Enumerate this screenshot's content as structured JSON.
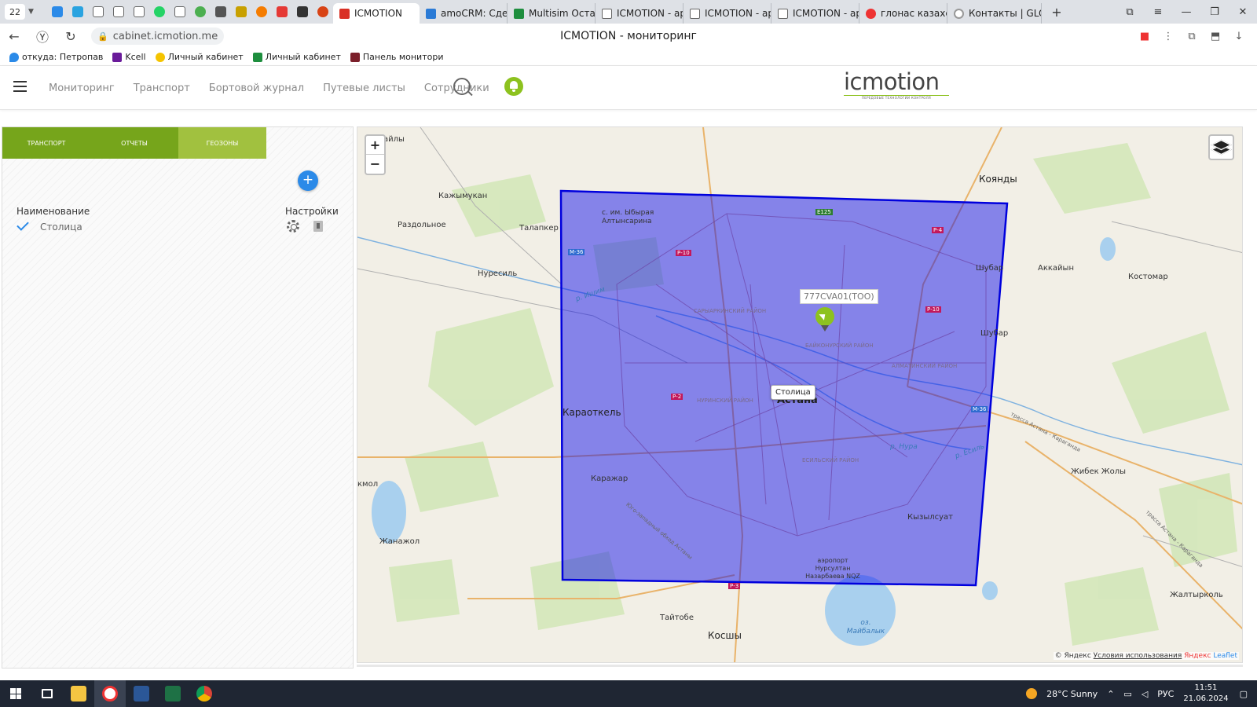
{
  "browser": {
    "tab_counter": "22",
    "tabs": [
      {
        "label": "ICMOTION",
        "color": "#d93025"
      },
      {
        "label": "amoCRM: Сдел",
        "color": "#2b7bd6"
      },
      {
        "label": "Multisim Остат",
        "color": "#1e8e3e"
      },
      {
        "label": "ICMOTION - ар",
        "color": "#666666"
      },
      {
        "label": "ICMOTION - ар",
        "color": "#666666"
      },
      {
        "label": "ICMOTION - ар",
        "color": "#666666"
      },
      {
        "label": "глонас казахст",
        "color": "#e33"
      },
      {
        "label": "Контакты | GLO",
        "color": "#999999"
      }
    ],
    "url": "cabinet.icmotion.me",
    "page_title": "ICMOTION - мониторинг",
    "bookmarks": [
      {
        "label": "откуда: Петропав",
        "color": "#2b8ae8"
      },
      {
        "label": "Kcell",
        "color": "#6a1b9a"
      },
      {
        "label": "Личный кабинет",
        "color": "#f5c400"
      },
      {
        "label": "Личный кабинет",
        "color": "#1e8e3e"
      },
      {
        "label": "Панель монитори",
        "color": "#7b1f2a"
      }
    ]
  },
  "header": {
    "nav": [
      "Мониторинг",
      "Транспорт",
      "Бортовой журнал",
      "Путевые листы",
      "Сотрудники"
    ],
    "logo_text": "icmotion",
    "logo_sub": "ПЕРЕДОВЫЕ ТЕХНОЛОГИИ КОНТРОЛЯ",
    "accent": "#8dc21f"
  },
  "panel": {
    "tabs": [
      "ТРАНСПОРТ",
      "ОТЧЕТЫ",
      "ГЕОЗОНЫ"
    ],
    "active_tab": "ГЕОЗОНЫ",
    "add_label": "+",
    "col_name": "Наименование",
    "col_settings": "Настройки",
    "rows": [
      {
        "name": "Столица",
        "checked": true
      }
    ]
  },
  "map": {
    "zoom_in": "+",
    "zoom_out": "−",
    "geozone_color": "#0000dd",
    "geozone_tooltip": "Столица",
    "vehicle_label": "777CVA01(ТОО)",
    "labels": {
      "kazhymukan": "Кажымукан",
      "razdolnoe": "Раздольное",
      "talapker": "Талапкер",
      "nuresil": "Нуресиль",
      "koyandy": "Коянды",
      "shubar1": "Шубар",
      "shubar2": "Шубар",
      "akkaiyn": "Аккайын",
      "kostomar": "Костомар",
      "karaotkel": "Караоткель",
      "karazhar": "Каражар",
      "zhanazhol": "Жанажол",
      "kyzylsuat": "Кызылсуат",
      "zhibek": "Жибек Жолы",
      "zhaltyrkol": "Жалтырколь",
      "taitobe": "Тайтобе",
      "kosshy": "Косшы",
      "astana": "Астана",
      "altynsarin": "с. им. Ыбырая Алтынсарина",
      "aily": "айлы",
      "akmol": "кмол",
      "airport": "аэропорт Нурсултан Назарбаева NQZ",
      "maibalyk": "оз. Майбалык",
      "saryarka": "САРЫАРКИНСКИЙ РАЙОН",
      "baikonur": "БАЙКОНУРСКИЙ РАЙОН",
      "almaty": "АЛМАТИНСКИЙ РАЙОН",
      "esil": "ЕСИЛЬСКИЙ РАЙОН",
      "nura": "НУРИНСКИЙ РАЙОН",
      "trassa1": "трасса Астана - Караганда",
      "trassa2": "трасса Астана - Караганда",
      "obhod": "Юго-западный обход Астаны",
      "r_ishim": "р. Ишим",
      "r_esil": "р. Есиль",
      "r_nura": "р. Нура"
    },
    "roads": [
      "E125",
      "Р-4",
      "Р-10",
      "М-36",
      "Р-2",
      "Р-10",
      "Р-3",
      "М-36"
    ],
    "attribution": {
      "prefix": "© Яндекс",
      "terms": "Условия использования",
      "yandex": "Яндекс",
      "leaflet": "Leaflet"
    }
  },
  "taskbar": {
    "weather": "28°C  Sunny",
    "lang": "РУС",
    "time": "11:51",
    "date": "21.06.2024"
  }
}
